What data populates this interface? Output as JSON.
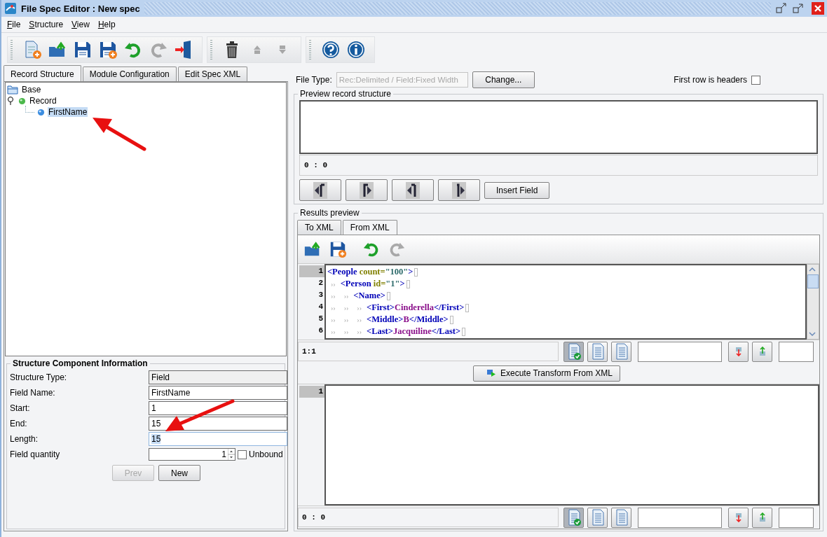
{
  "window": {
    "title": "File Spec Editor : New spec"
  },
  "menu": [
    {
      "label": "File"
    },
    {
      "label": "Structure"
    },
    {
      "label": "View"
    },
    {
      "label": "Help"
    }
  ],
  "toolbar": [
    [
      {
        "kind": "new",
        "disabled": false
      },
      {
        "kind": "open",
        "disabled": false
      },
      {
        "kind": "save",
        "disabled": false
      },
      {
        "kind": "saveas",
        "disabled": false
      },
      {
        "kind": "undo",
        "disabled": false
      },
      {
        "kind": "redo",
        "disabled": true
      },
      {
        "kind": "exit",
        "disabled": false
      }
    ],
    [
      {
        "kind": "delete",
        "disabled": false
      },
      {
        "kind": "up",
        "disabled": true
      },
      {
        "kind": "down",
        "disabled": true
      }
    ],
    [
      {
        "kind": "help",
        "disabled": false
      },
      {
        "kind": "info",
        "disabled": false
      }
    ]
  ],
  "tabs": [
    {
      "label": "Record Structure",
      "selected": true
    },
    {
      "label": "Module Configuration",
      "selected": false
    },
    {
      "label": "Edit Spec XML",
      "selected": false
    }
  ],
  "tree": {
    "label": "Base",
    "children": [
      {
        "label": "Record",
        "expanded": true,
        "selected": false,
        "children": [
          {
            "label": "FirstName",
            "selected": true
          }
        ]
      }
    ]
  },
  "component_info": {
    "title": "Structure Component Information",
    "fields": [
      {
        "label": "Structure Type:",
        "value": "Field",
        "kind": "readonly"
      },
      {
        "label": "Field Name:",
        "value": "FirstName",
        "kind": "text"
      },
      {
        "label": "Start:",
        "value": "1",
        "kind": "text"
      },
      {
        "label": "End:",
        "value": "15",
        "kind": "text"
      },
      {
        "label": "Length:",
        "value": "15",
        "kind": "focused"
      },
      {
        "label": "Field quantity",
        "value": "1",
        "kind": "spinner",
        "option": {
          "label": "Unbound",
          "checked": false
        }
      }
    ],
    "buttons": [
      {
        "label": "Prev",
        "disabled": true
      },
      {
        "label": "New",
        "disabled": false
      }
    ]
  },
  "file_type": {
    "label": "File Type:",
    "value": "Rec:Delimited / Field:Fixed Width",
    "button": "Change...",
    "headers": {
      "label": "First row is headers",
      "checked": false
    }
  },
  "preview": {
    "title": "Preview record structure",
    "position": "0 : 0",
    "nav": [
      {
        "kind": "left-start"
      },
      {
        "kind": "right-start"
      },
      {
        "kind": "left-end"
      },
      {
        "kind": "right-end"
      }
    ],
    "insert": "Insert Field"
  },
  "results": {
    "title": "Results preview",
    "tabs": [
      {
        "label": "To XML",
        "selected": false
      },
      {
        "label": "From XML",
        "selected": true
      }
    ],
    "toolbar": [
      {
        "kind": "open",
        "disabled": false
      },
      {
        "kind": "saveas",
        "disabled": false
      },
      {
        "kind": "undo",
        "disabled": false
      },
      {
        "kind": "redo",
        "disabled": true
      }
    ],
    "lines": [
      {
        "no": "1",
        "current": true,
        "segments": [
          {
            "kind": "tag",
            "text": "<People"
          },
          {
            "kind": "attr",
            "text": " count="
          },
          {
            "kind": "value",
            "text": "\"100\""
          },
          {
            "kind": "tag",
            "text": ">"
          }
        ]
      },
      {
        "no": "2",
        "current": false,
        "segments": [
          {
            "kind": "ws",
            "text": "››"
          },
          {
            "kind": "tag",
            "text": "<Person"
          },
          {
            "kind": "attr",
            "text": " id="
          },
          {
            "kind": "value",
            "text": "\"1\""
          },
          {
            "kind": "tag",
            "text": ">"
          }
        ]
      },
      {
        "no": "3",
        "current": false,
        "segments": [
          {
            "kind": "ws",
            "text": "››"
          },
          {
            "kind": "ws",
            "text": "››"
          },
          {
            "kind": "tag",
            "text": "<Name>"
          }
        ]
      },
      {
        "no": "4",
        "current": false,
        "segments": [
          {
            "kind": "ws",
            "text": "››"
          },
          {
            "kind": "ws",
            "text": "››"
          },
          {
            "kind": "ws",
            "text": "››"
          },
          {
            "kind": "tag",
            "text": "<First>"
          },
          {
            "kind": "text",
            "text": "Cinderella"
          },
          {
            "kind": "tag",
            "text": "</First>"
          }
        ]
      },
      {
        "no": "5",
        "current": false,
        "segments": [
          {
            "kind": "ws",
            "text": "››"
          },
          {
            "kind": "ws",
            "text": "››"
          },
          {
            "kind": "ws",
            "text": "››"
          },
          {
            "kind": "tag",
            "text": "<Middle>"
          },
          {
            "kind": "text",
            "text": "B"
          },
          {
            "kind": "tag",
            "text": "</Middle>"
          }
        ]
      },
      {
        "no": "6",
        "current": false,
        "segments": [
          {
            "kind": "ws",
            "text": "››"
          },
          {
            "kind": "ws",
            "text": "››"
          },
          {
            "kind": "ws",
            "text": "››"
          },
          {
            "kind": "tag",
            "text": "<Last>"
          },
          {
            "kind": "text",
            "text": "Jacquiline"
          },
          {
            "kind": "tag",
            "text": "</Last>"
          }
        ]
      }
    ],
    "caret": "1:1",
    "execute": "Execute Transform From XML",
    "output_lines": [
      {
        "no": "1",
        "current": true
      }
    ],
    "output_caret": "0 : 0"
  }
}
